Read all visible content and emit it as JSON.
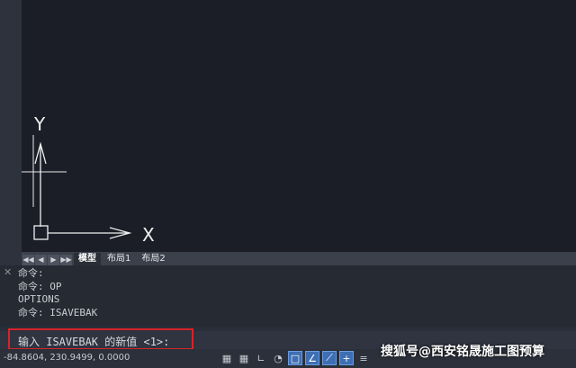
{
  "colors": {
    "viewport_bg": "#1b1e27",
    "ui_bg": "#2a2e38",
    "highlight_border": "#d7232a",
    "status_on": "#3e6fb4"
  },
  "ucs": {
    "y_label": "Y",
    "x_label": "X"
  },
  "layout_tabs": {
    "nav_buttons": [
      "◀◀",
      "◀",
      "▶",
      "▶▶"
    ],
    "tabs": [
      {
        "label": "模型",
        "active": true
      },
      {
        "label": "布局1",
        "active": false
      },
      {
        "label": "布局2",
        "active": false
      }
    ]
  },
  "command_history": {
    "close_icon": "✕",
    "lines": [
      "命令:",
      "命令: OP",
      "OPTIONS",
      "命令: ISAVEBAK"
    ]
  },
  "command_input": {
    "prompt": "输入 ISAVEBAK 的新值 <1>:"
  },
  "status": {
    "coordinates": "-84.8604, 230.9499, 0.0000",
    "icons": [
      {
        "name": "grid-icon",
        "glyph": "▦",
        "on": false
      },
      {
        "name": "snap-grid-icon",
        "glyph": "▦",
        "on": false
      },
      {
        "name": "ortho-icon",
        "glyph": "∟",
        "on": false
      },
      {
        "name": "polar-icon",
        "glyph": "◔",
        "on": false
      },
      {
        "name": "osnap-icon",
        "glyph": "□",
        "on": true
      },
      {
        "name": "otrack-icon",
        "glyph": "∠",
        "on": true
      },
      {
        "name": "dynamic-ucs-icon",
        "glyph": "⟋",
        "on": true
      },
      {
        "name": "dynamic-input-icon",
        "glyph": "+",
        "on": true
      },
      {
        "name": "lineweight-icon",
        "glyph": "≡",
        "on": false
      }
    ]
  },
  "watermark": "搜狐号@西安铭晟施工图预算"
}
